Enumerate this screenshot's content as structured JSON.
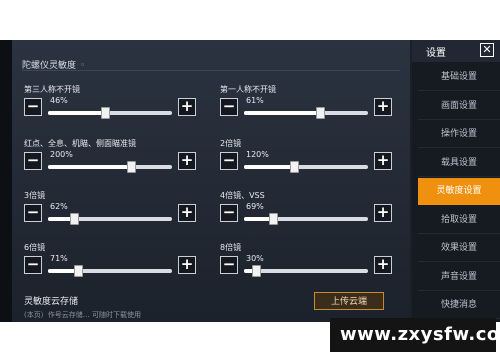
{
  "panel": {
    "title": "陀螺仪灵敏度",
    "title_mark": "◦"
  },
  "sliders": [
    {
      "label": "第三人称不开镜",
      "value": "46%",
      "fraction": 0.46
    },
    {
      "label": "第一人称不开镜",
      "value": "61%",
      "fraction": 0.61
    },
    {
      "label": "红点、全息、机瞄、侧面瞄准镜",
      "value": "200%",
      "fraction": 0.67
    },
    {
      "label": "2倍镜",
      "value": "120%",
      "fraction": 0.4
    },
    {
      "label": "3倍镜",
      "value": "62%",
      "fraction": 0.21
    },
    {
      "label": "4倍镜、VSS",
      "value": "69%",
      "fraction": 0.23
    },
    {
      "label": "6倍镜",
      "value": "71%",
      "fraction": 0.24
    },
    {
      "label": "8倍镜",
      "value": "30%",
      "fraction": 0.1
    }
  ],
  "buttons": {
    "minus": "−",
    "plus": "+"
  },
  "cloud": {
    "title": "灵敏度云存储",
    "upload_label": "上传云端",
    "subtitle": "(本页）作号云存储… 可随时下载使用"
  },
  "nav": {
    "header": "设置",
    "close": "✕",
    "items": [
      "基础设置",
      "画面设置",
      "操作设置",
      "载具设置",
      "灵敏度设置",
      "拾取设置",
      "效果设置",
      "声音设置",
      "快捷消息"
    ],
    "active_index": 4
  },
  "watermark": "www.zxysfw.com",
  "colors": {
    "accent": "#f0900f",
    "panel_bg": "#222934"
  }
}
